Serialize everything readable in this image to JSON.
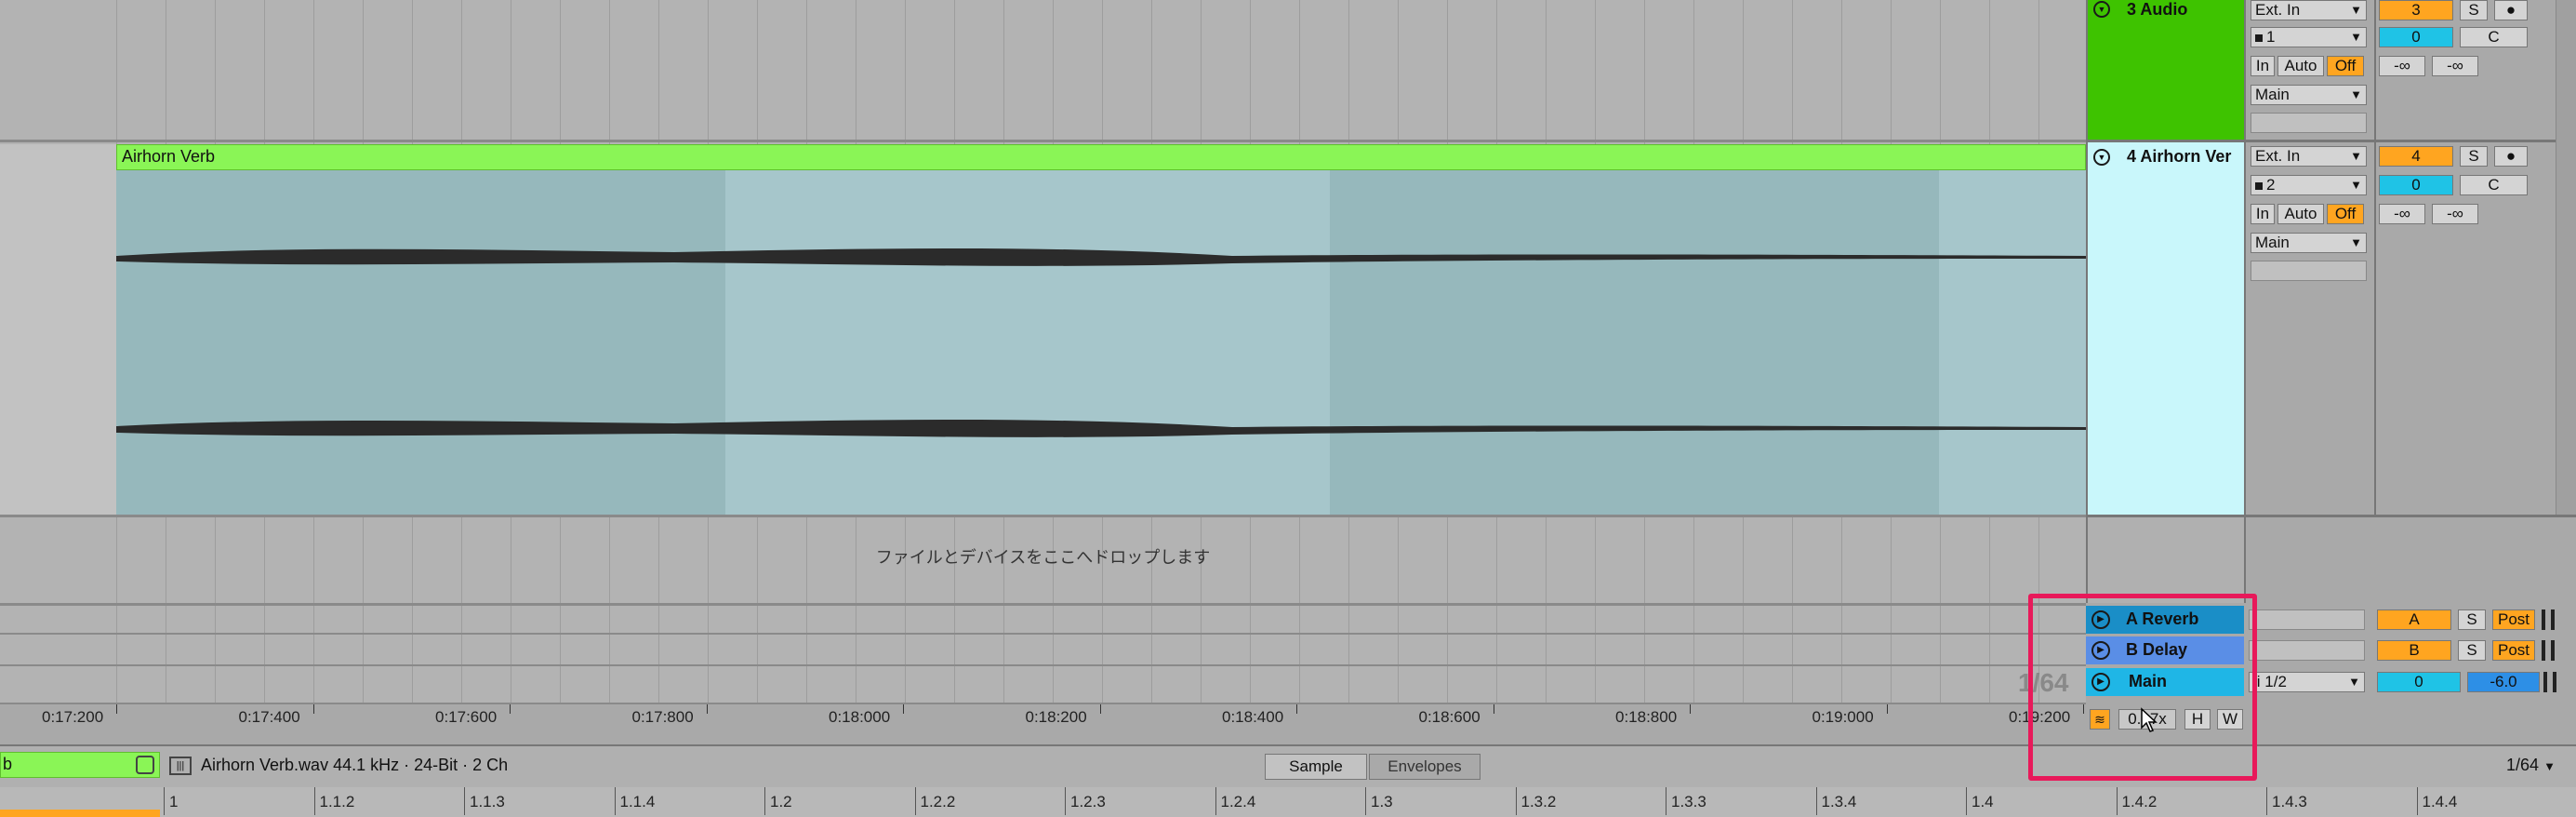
{
  "tracks": {
    "audio3": {
      "name": "3 Audio",
      "input": "Ext. In",
      "channel": "1",
      "monitor": [
        "In",
        "Auto",
        "Off"
      ],
      "output": "Main",
      "number": "3",
      "solo": "S",
      "volume": "0",
      "pan": "C",
      "peak_l": "-∞",
      "peak_r": "-∞"
    },
    "audio4": {
      "name": "4 Airhorn Ver",
      "input": "Ext. In",
      "channel": "2",
      "monitor": [
        "In",
        "Auto",
        "Off"
      ],
      "output": "Main",
      "number": "4",
      "solo": "S",
      "volume": "0",
      "pan": "C",
      "peak_l": "-∞",
      "peak_r": "-∞"
    }
  },
  "clip": {
    "name": "Airhorn Verb"
  },
  "drop_hint": "ファイルとデバイスをここへドロップします",
  "returns": [
    {
      "name": "A Reverb",
      "letter": "A",
      "solo": "S",
      "post": "Post"
    },
    {
      "name": "B Delay",
      "letter": "B",
      "solo": "S",
      "post": "Post"
    }
  ],
  "main": {
    "name": "Main",
    "ratio": "1/2",
    "volume": "0",
    "level": "-6.0"
  },
  "grid_overlay": "1/64",
  "timeline": [
    "0:17:200",
    "0:17:400",
    "0:17:600",
    "0:17:800",
    "0:18:000",
    "0:18:200",
    "0:18:400",
    "0:18:600",
    "0:18:800",
    "0:19:000",
    "0:19:200"
  ],
  "zoom": {
    "value": "0.17x",
    "h": "H",
    "w": "W"
  },
  "clipview": {
    "left_label": "b",
    "file_info": "Airhorn Verb.wav  44.1 kHz · 24-Bit · 2 Ch",
    "tabs": [
      "Sample",
      "Envelopes"
    ],
    "grid": "1/64",
    "ruler": [
      "1",
      "1.1.2",
      "1.1.3",
      "1.1.4",
      "1.2",
      "1.2.2",
      "1.2.3",
      "1.2.4",
      "1.3",
      "1.3.2",
      "1.3.3",
      "1.3.4",
      "1.4",
      "1.4.2",
      "1.4.3",
      "1.4.4"
    ]
  },
  "colors": {
    "track3": "#3ec300",
    "track4": "#c9f7fb",
    "clip_header": "#8af556",
    "highlight": "#e8195a"
  }
}
